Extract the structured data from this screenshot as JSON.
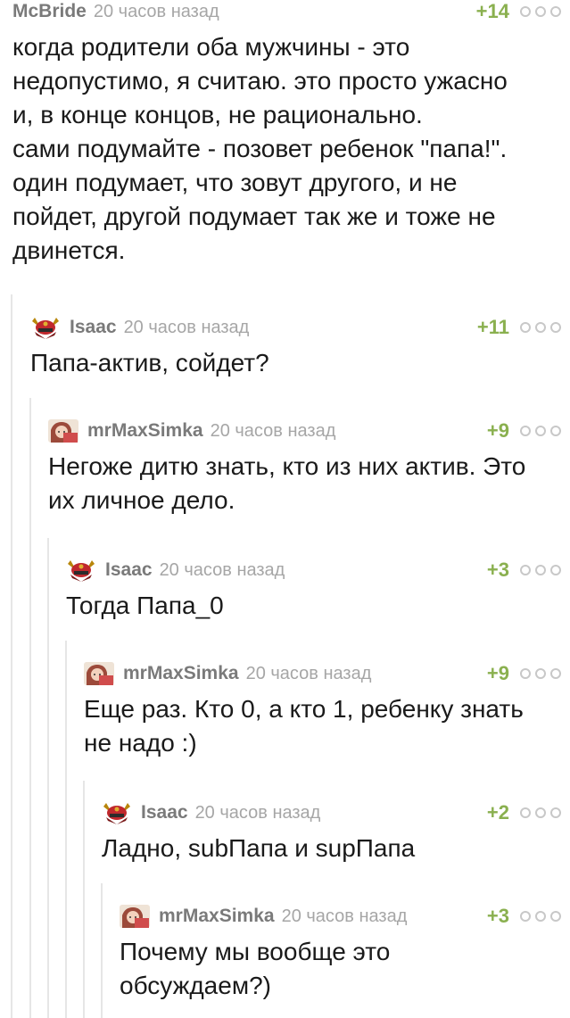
{
  "comments": [
    {
      "author": "McBride",
      "time": "20 часов назад",
      "rating": "+14",
      "text": "когда родители оба мужчины - это\nнедопустимо, я считаю. это просто ужасно\nи, в конце концов, не рационально.\nсами подумайте - позовет ребенок \"папа!\".\nодин подумает, что зовут другого, и не\nпойдет, другой подумает так же и тоже не\nдвинется.",
      "avatar": "none"
    },
    {
      "author": "Isaac",
      "time": "20 часов назад",
      "rating": "+11",
      "text": "Папа-актив, сойдет?",
      "avatar": "samurai-helmet-icon"
    },
    {
      "author": "mrMaxSimka",
      "time": "20 часов назад",
      "rating": "+9",
      "text": "Негоже дитю знать, кто из них актив. Это\nих личное дело.",
      "avatar": "anime-girl-avatar"
    },
    {
      "author": "Isaac",
      "time": "20 часов назад",
      "rating": "+3",
      "text": "Тогда Папа_0",
      "avatar": "samurai-helmet-icon"
    },
    {
      "author": "mrMaxSimka",
      "time": "20 часов назад",
      "rating": "+9",
      "text": "Еще раз. Кто 0, а кто 1, ребенку знать\nне надо :)",
      "avatar": "anime-girl-avatar"
    },
    {
      "author": "Isaac",
      "time": "20 часов назад",
      "rating": "+2",
      "text": "Ладно, subПапа и supПапа",
      "avatar": "samurai-helmet-icon"
    },
    {
      "author": "mrMaxSimka",
      "time": "20 часов назад",
      "rating": "+3",
      "text": "Почему мы вообще это\nобсуждаем?)",
      "avatar": "anime-girl-avatar"
    }
  ],
  "colors": {
    "author": "#7a7a7a",
    "time": "#a6a6a6",
    "rating_positive": "#8ab04f",
    "text": "#1a1a1a",
    "thread_line": "#e6e6e6"
  }
}
